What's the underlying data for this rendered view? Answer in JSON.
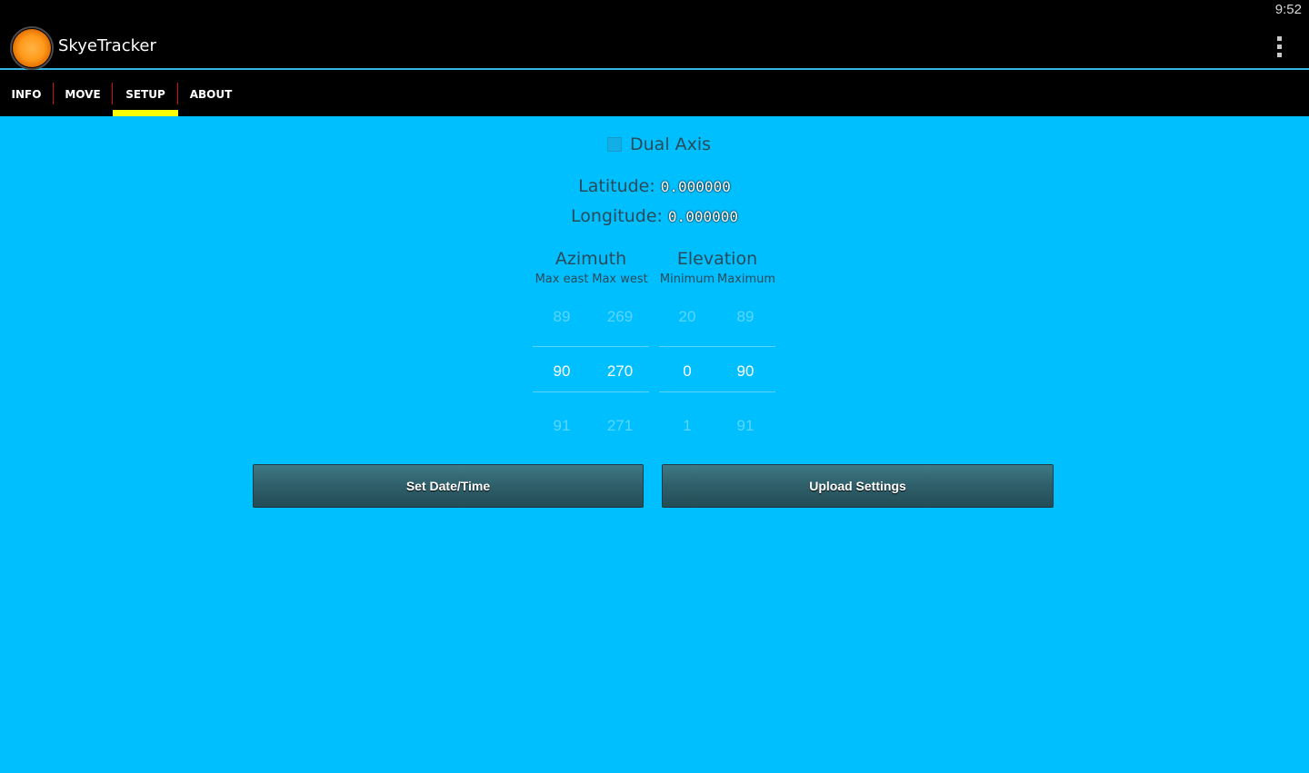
{
  "status_bar": {
    "time": "9:52"
  },
  "action_bar": {
    "title": "SkyeTracker",
    "menu_icon": "overflow-menu-icon"
  },
  "tabs": [
    {
      "label": "INFO",
      "selected": false
    },
    {
      "label": "MOVE",
      "selected": false
    },
    {
      "label": "SETUP",
      "selected": true
    },
    {
      "label": "ABOUT",
      "selected": false
    }
  ],
  "setup": {
    "dual_axis": {
      "label": "Dual Axis",
      "checked": false
    },
    "latitude": {
      "label": "Latitude:",
      "value": "0.000000"
    },
    "longitude": {
      "label": "Longitude:",
      "value": "0.000000"
    },
    "azimuth": {
      "title": "Azimuth",
      "max_east": {
        "label": "Max east",
        "prev": "89",
        "value": "90",
        "next": "91"
      },
      "max_west": {
        "label": "Max west",
        "prev": "269",
        "value": "270",
        "next": "271"
      }
    },
    "elevation": {
      "title": "Elevation",
      "minimum": {
        "label": "Minimum",
        "prev": "20",
        "value": "0",
        "next": "1"
      },
      "maximum": {
        "label": "Maximum",
        "prev": "89",
        "value": "90",
        "next": "91"
      }
    },
    "buttons": {
      "set_datetime": "Set Date/Time",
      "upload_settings": "Upload Settings"
    }
  },
  "colors": {
    "background": "#00bfff",
    "tab_indicator": "#ffff00",
    "tab_separator": "#d01010",
    "action_bar_divider": "#33b5e5",
    "button": "#2e5f6a"
  }
}
